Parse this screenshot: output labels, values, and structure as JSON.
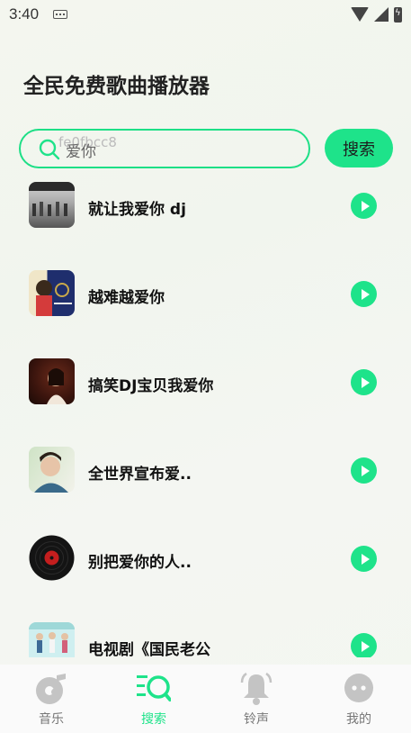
{
  "status_bar": {
    "time": "3:40"
  },
  "page_title": "全民免费歌曲播放器",
  "search": {
    "value": "爱你",
    "ghost_text": "fe0fbcc8",
    "button_label": "搜索"
  },
  "songs": [
    {
      "title": "就让我爱你 dj",
      "cover": "dance-cover"
    },
    {
      "title": "越难越爱你",
      "cover": "portrait-cover"
    },
    {
      "title": "搞笑DJ宝贝我爱你",
      "cover": "woman-cover"
    },
    {
      "title": "全世界宣布爱..",
      "cover": "man-cover"
    },
    {
      "title": "别把爱你的人..",
      "cover": "vinyl-cover"
    },
    {
      "title": "电视剧《国民老公",
      "cover": "drama-cover"
    }
  ],
  "tabs": [
    {
      "label": "音乐",
      "icon": "music-disc-icon"
    },
    {
      "label": "搜索",
      "icon": "search-list-icon"
    },
    {
      "label": "铃声",
      "icon": "bell-icon"
    },
    {
      "label": "我的",
      "icon": "profile-dots-icon"
    }
  ],
  "colors": {
    "accent": "#1ee38a",
    "inactive": "#bfbfbf"
  }
}
